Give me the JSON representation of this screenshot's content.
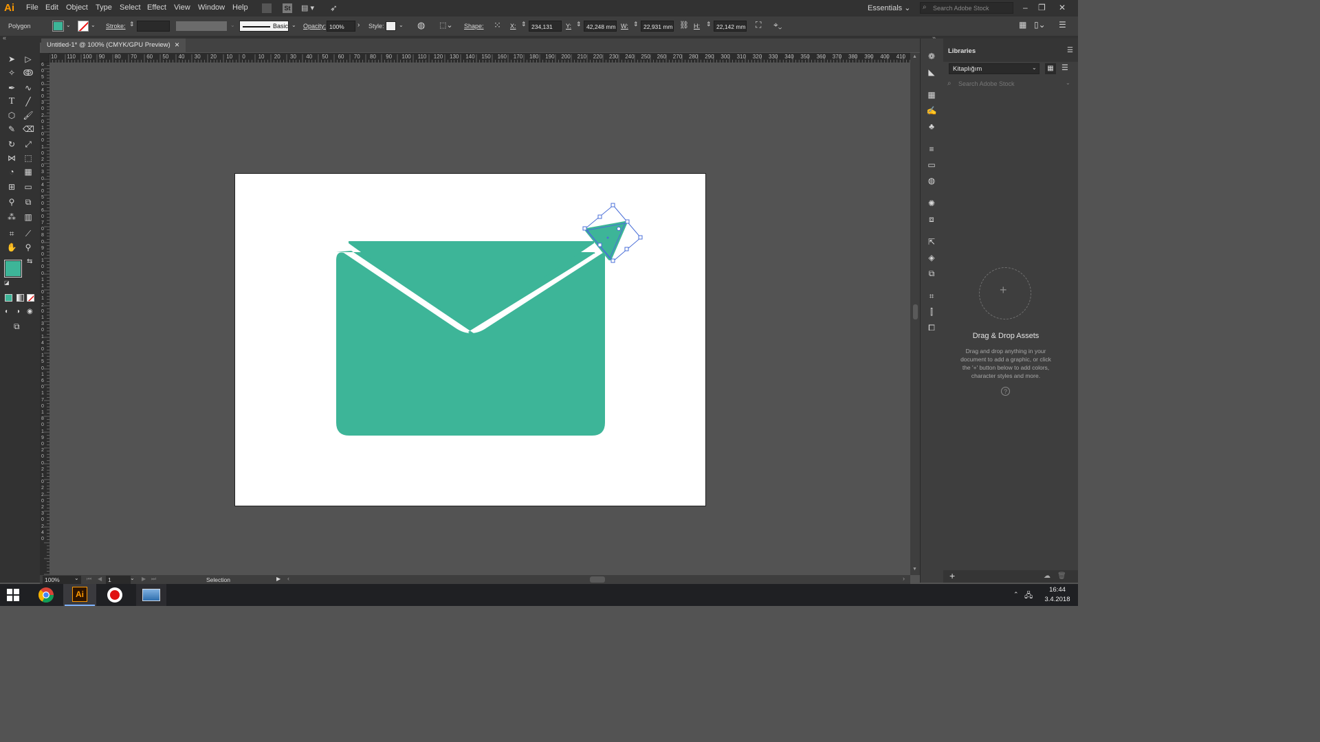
{
  "app": {
    "logo": "Ai",
    "menu": [
      "File",
      "Edit",
      "Object",
      "Type",
      "Select",
      "Effect",
      "View",
      "Window",
      "Help"
    ],
    "bridge_label": "St",
    "workspace": "Essentials",
    "search_placeholder": "Search Adobe Stock"
  },
  "control_bar": {
    "selection_type": "Polygon",
    "fill_color": "#3db598",
    "stroke_label": "Stroke:",
    "brush_label": "Basic",
    "opacity_label": "Opacity:",
    "opacity_value": "100%",
    "style_label": "Style:",
    "shape_label": "Shape:",
    "x_label": "X:",
    "x_value": "234,131 mm",
    "y_label": "Y:",
    "y_value": "42,248 mm",
    "w_label": "W:",
    "w_value": "22,931 mm",
    "h_label": "H:",
    "h_value": "22,142 mm"
  },
  "document": {
    "tab_title": "Untitled-1* @ 100% (CMYK/GPU Preview)",
    "close_glyph": "×"
  },
  "ruler": {
    "h_labels": [
      "10",
      "110",
      "100",
      "90",
      "80",
      "70",
      "60",
      "50",
      "40",
      "30",
      "20",
      "10",
      "0",
      "10",
      "20",
      "30",
      "40",
      "50",
      "60",
      "70",
      "80",
      "90",
      "100",
      "110",
      "120",
      "130",
      "140",
      "150",
      "160",
      "170",
      "180",
      "190",
      "200",
      "210",
      "220",
      "230",
      "240",
      "250",
      "260",
      "270",
      "280",
      "290",
      "300",
      "310",
      "320",
      "330",
      "340",
      "350",
      "360",
      "370",
      "380",
      "390",
      "400",
      "410",
      "42"
    ],
    "v_labels": [
      "6",
      "0",
      "5",
      "0",
      "4",
      "0",
      "3",
      "0",
      "2",
      "0",
      "1",
      "0",
      "0",
      "1",
      "0",
      "2",
      "0",
      "3",
      "0",
      "4",
      "0",
      "5",
      "0",
      "6",
      "0",
      "7",
      "0",
      "8",
      "0",
      "9",
      "0",
      "1",
      "0",
      "0",
      "1",
      "1",
      "0",
      "1",
      "2",
      "0",
      "1",
      "3",
      "0",
      "1",
      "4",
      "0",
      "1",
      "5",
      "0",
      "1",
      "6",
      "0",
      "1",
      "7",
      "0",
      "1",
      "8",
      "0",
      "1",
      "9",
      "0",
      "2",
      "0",
      "0",
      "2",
      "1",
      "0",
      "2",
      "2",
      "0",
      "2",
      "3",
      "0",
      "2",
      "4",
      "0"
    ]
  },
  "artwork": {
    "envelope_color": "#3db598",
    "selection_color": "#4a6fd8"
  },
  "status": {
    "zoom": "100%",
    "artboard_number": "1",
    "tool_name": "Selection"
  },
  "libraries": {
    "panel_title": "Libraries",
    "library_name": "Kitaplığım",
    "search_placeholder": "Search Adobe Stock",
    "drop_title": "Drag & Drop Assets",
    "drop_text_1": "Drag and drop anything in your",
    "drop_text_2": "document to add a graphic, or click",
    "drop_text_3": "the '+' button below to add colors,",
    "drop_text_4": "character styles and more.",
    "help_glyph": "?",
    "add_glyph": "+"
  },
  "taskbar": {
    "time": "16:44",
    "date": "3.4.2018",
    "ai_label": "Ai"
  }
}
